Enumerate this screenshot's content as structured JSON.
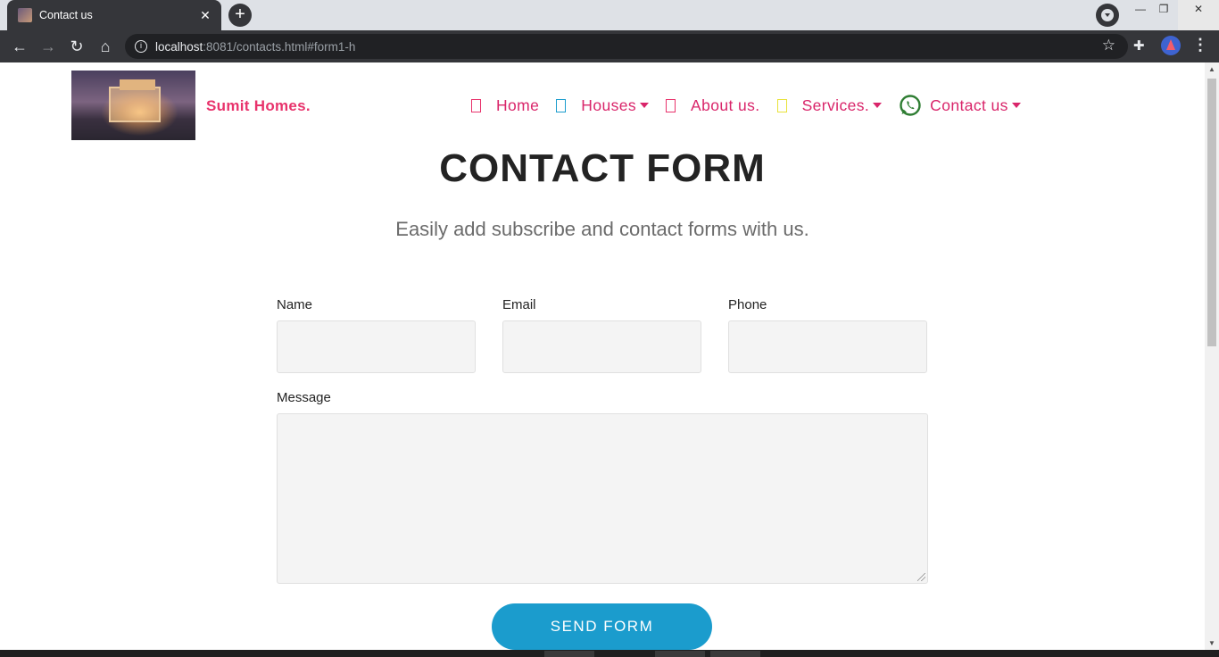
{
  "browser": {
    "tab_title": "Contact us",
    "tab_close": "✕",
    "new_tab": "+",
    "url_host": "localhost",
    "url_rest": ":8081/contacts.html#form1-h",
    "window_controls": [
      "—",
      "❐",
      "✕"
    ]
  },
  "site": {
    "brand": "Sumit Homes.",
    "nav": [
      {
        "label": "Home",
        "color": "#e8336c",
        "dropdown": false
      },
      {
        "label": "Houses",
        "color": "#1b9ccd",
        "dropdown": true
      },
      {
        "label": "About us.",
        "color": "#e8336c",
        "dropdown": false
      },
      {
        "label": "Services.",
        "color": "#e8e23a",
        "dropdown": true
      },
      {
        "label": "Contact us",
        "icon": "whatsapp-icon",
        "color": "#2e7d32",
        "dropdown": true
      }
    ]
  },
  "form": {
    "title": "CONTACT FORM",
    "subtitle": "Easily add subscribe and contact forms with us.",
    "name_label": "Name",
    "email_label": "Email",
    "phone_label": "Phone",
    "message_label": "Message",
    "submit_label": "SEND FORM"
  },
  "colors": {
    "accent": "#d9256a",
    "button": "#1b9ccd"
  }
}
